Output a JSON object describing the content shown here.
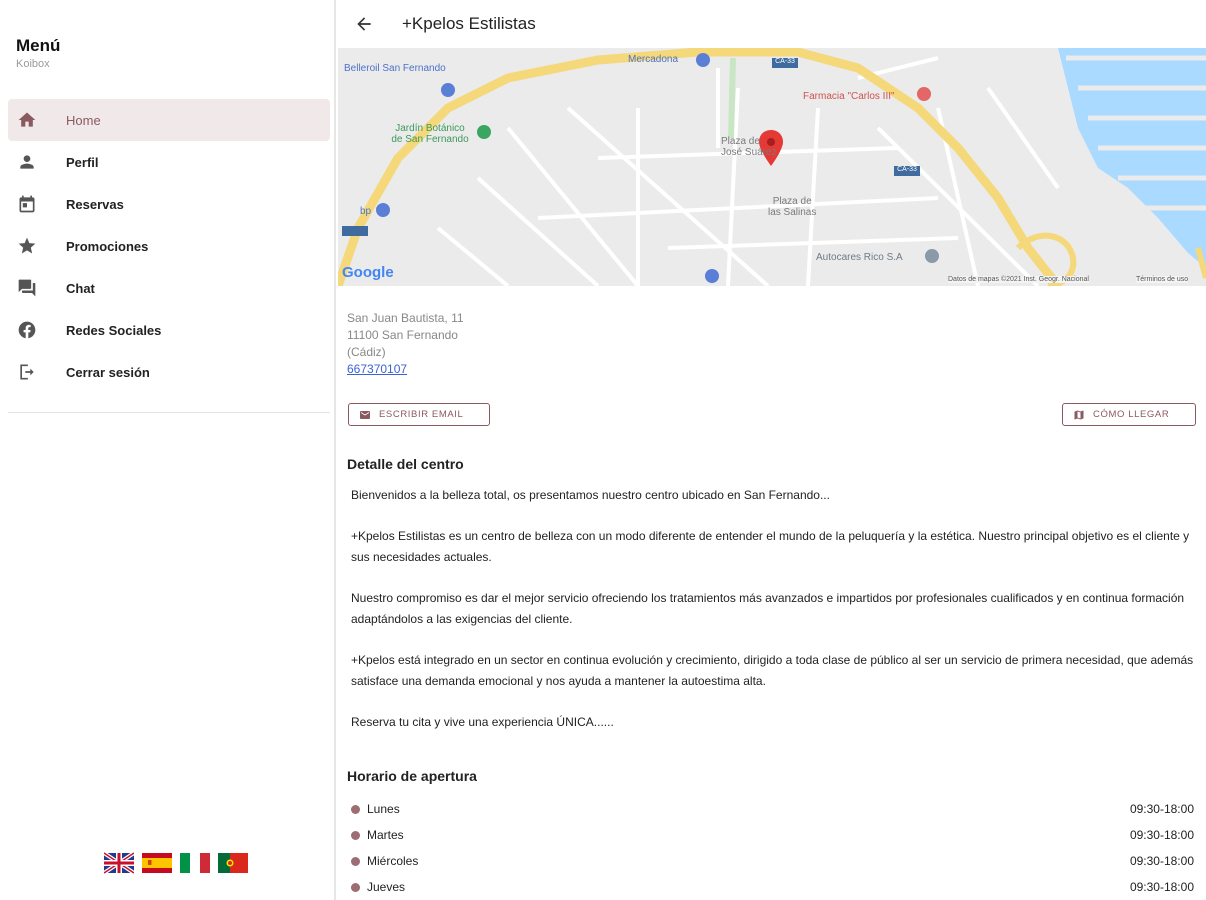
{
  "sidebar": {
    "title": "Menú",
    "subtitle": "Koibox",
    "items": [
      {
        "label": "Home",
        "icon": "home-icon",
        "active": true
      },
      {
        "label": "Perfil",
        "icon": "person-icon",
        "active": false
      },
      {
        "label": "Reservas",
        "icon": "calendar-icon",
        "active": false
      },
      {
        "label": "Promociones",
        "icon": "star-icon",
        "active": false
      },
      {
        "label": "Chat",
        "icon": "chat-icon",
        "active": false
      },
      {
        "label": "Redes Sociales",
        "icon": "facebook-icon",
        "active": false
      },
      {
        "label": "Cerrar sesión",
        "icon": "logout-icon",
        "active": false
      }
    ],
    "languages": [
      "uk-flag-icon",
      "spain-flag-icon",
      "italy-flag-icon",
      "portugal-flag-icon"
    ]
  },
  "header": {
    "title": "+Kpelos Estilistas"
  },
  "map": {
    "labels": {
      "belleroil": "Belleroil San Fernando",
      "mercadona": "Mercadona",
      "farmacia": "Farmacia \"Carlos III\"",
      "jardin": "Jardín Botánico\nde San Fernando",
      "plaza_jose": "Plaza de\nJosé Suárez",
      "plaza_salinas": "Plaza de\nlas Salinas",
      "autocares": "Autocares Rico S.A",
      "bp": "bp",
      "google": "Google",
      "attribution": "Datos de mapas ©2021 Inst. Geogr. Nacional",
      "terms": "Términos de uso",
      "road_ca33": "CA-33",
      "road_ca33b": "CA-33"
    }
  },
  "info": {
    "address_line1": "San Juan Bautista, 11",
    "address_line2": "11100 San Fernando",
    "address_line3": "(Cádiz)",
    "phone": "667370107",
    "email_button": "ESCRIBIR EMAIL",
    "route_button": "CÓMO LLEGAR"
  },
  "detail": {
    "title": "Detalle del centro",
    "paragraphs": [
      "Bienvenidos a la belleza total, os presentamos nuestro centro ubicado en San Fernando...",
      "+Kpelos Estilistas es un centro de belleza con un modo diferente de entender el mundo de la peluquería y la estética. Nuestro principal objetivo es el cliente y sus necesidades actuales.",
      "Nuestro compromiso es dar el mejor servicio ofreciendo los tratamientos más avanzados e impartidos por profesionales cualificados y en continua formación adaptándolos a las exigencias del cliente.",
      "+Kpelos está integrado en un sector en continua evolución y crecimiento, dirigido a toda clase de público al ser un servicio de primera necesidad, que además satisface una demanda emocional y nos ayuda a mantener la autoestima alta.",
      "Reserva tu cita y vive una experiencia ÚNICA......"
    ]
  },
  "hours": {
    "title": "Horario de apertura",
    "rows": [
      {
        "day": "Lunes",
        "time": "09:30-18:00"
      },
      {
        "day": "Martes",
        "time": "09:30-18:00"
      },
      {
        "day": "Miércoles",
        "time": "09:30-18:00"
      },
      {
        "day": "Jueves",
        "time": "09:30-18:00"
      }
    ]
  },
  "colors": {
    "accent": "#8b5a60",
    "active_bg": "#f1e9e9",
    "link": "#3b62d6"
  }
}
